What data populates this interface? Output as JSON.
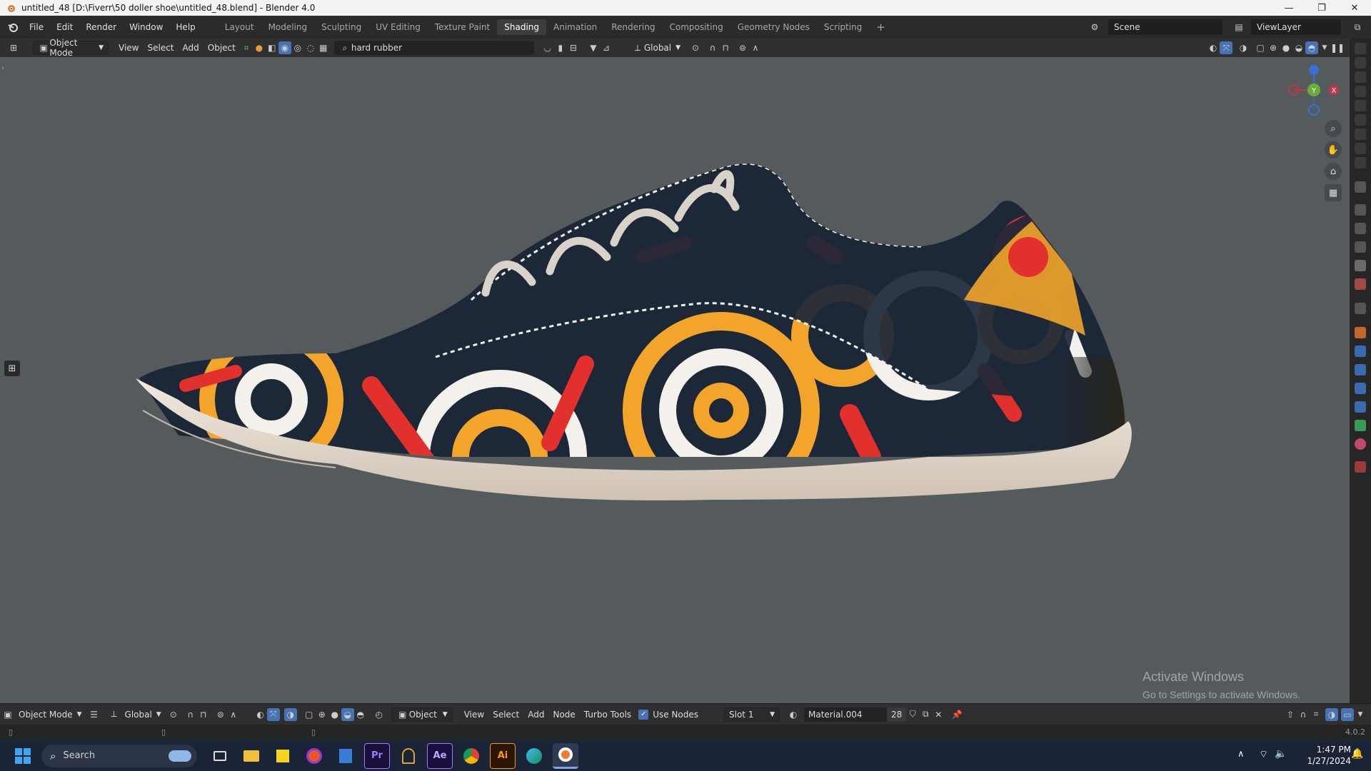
{
  "window": {
    "title": "untitled_48 [D:\\Fiverr\\50 doller shoe\\untitled_48.blend] - Blender 4.0",
    "minimize": "—",
    "maximize": "❐",
    "close": "✕"
  },
  "menu": [
    "File",
    "Edit",
    "Render",
    "Window",
    "Help"
  ],
  "workspaces": [
    {
      "label": "Layout",
      "active": false
    },
    {
      "label": "Modeling",
      "active": false
    },
    {
      "label": "Sculpting",
      "active": false
    },
    {
      "label": "UV Editing",
      "active": false
    },
    {
      "label": "Texture Paint",
      "active": false
    },
    {
      "label": "Shading",
      "active": true
    },
    {
      "label": "Animation",
      "active": false
    },
    {
      "label": "Rendering",
      "active": false
    },
    {
      "label": "Compositing",
      "active": false
    },
    {
      "label": "Geometry Nodes",
      "active": false
    },
    {
      "label": "Scripting",
      "active": false
    }
  ],
  "add_workspace": "+",
  "scene": {
    "name": "Scene",
    "view_layer": "ViewLayer"
  },
  "viewport_header": {
    "mode": "Object Mode",
    "view": "View",
    "select": "Select",
    "add": "Add",
    "object": "Object",
    "material_search": "hard rubber",
    "orientation": "Global"
  },
  "gizmo_axes": {
    "y": "Y",
    "x": "X",
    "z": "Z"
  },
  "node_header": {
    "mode": "Object Mode",
    "orientation": "Global",
    "object_type": "Object",
    "view": "View",
    "select": "Select",
    "add": "Add",
    "node": "Node",
    "turbo_tools": "Turbo Tools",
    "use_nodes": "Use Nodes",
    "use_nodes_checked": true,
    "slot": "Slot 1",
    "material": "Material.004",
    "users": "28"
  },
  "version": "4.0.2",
  "watermark": {
    "title": "Activate Windows",
    "subtitle": "Go to Settings to activate Windows."
  },
  "taskbar": {
    "search_placeholder": "Search",
    "apps": [
      {
        "icon": "task-view-icon",
        "label": ""
      },
      {
        "icon": "file-explorer-icon",
        "label": ""
      },
      {
        "icon": "sticky-notes-icon",
        "label": ""
      },
      {
        "icon": "firefox-icon",
        "label": ""
      },
      {
        "icon": "notepad-icon",
        "label": ""
      },
      {
        "icon": "premiere-icon",
        "label": "Pr"
      },
      {
        "icon": "blender-alt-icon",
        "label": ""
      },
      {
        "icon": "after-effects-icon",
        "label": "Ae"
      },
      {
        "icon": "chrome-icon",
        "label": ""
      },
      {
        "icon": "illustrator-icon",
        "label": "Ai"
      },
      {
        "icon": "edge-icon",
        "label": ""
      },
      {
        "icon": "blender-icon",
        "label": ""
      }
    ],
    "time": "1:47 PM",
    "date": "1/27/2024"
  },
  "colors": {
    "viewport_bg": "#555a5d",
    "shoe_navy": "#1c2738",
    "pattern_red": "#e2312c",
    "pattern_orange": "#f2a52a",
    "pattern_white": "#f4f1ec",
    "sole": "#e8ddd2",
    "active_blue": "#4772b3"
  }
}
